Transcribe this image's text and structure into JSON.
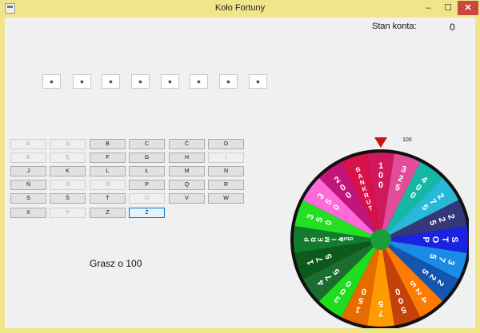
{
  "window": {
    "title": "Koło Fortuny",
    "minimize": "‒",
    "maximize": "☐",
    "close": "✕"
  },
  "balance": {
    "label": "Stan konta:",
    "value": "0"
  },
  "slots": [
    "●",
    "●",
    "●",
    "●",
    "●",
    "●",
    "●",
    "●"
  ],
  "keys": [
    {
      "label": "A",
      "enabled": false
    },
    {
      "label": "Ą",
      "enabled": false
    },
    {
      "label": "B",
      "enabled": true
    },
    {
      "label": "C",
      "enabled": true
    },
    {
      "label": "Ć",
      "enabled": true
    },
    {
      "label": "D",
      "enabled": true
    },
    {
      "label": "E",
      "enabled": false
    },
    {
      "label": "Ę",
      "enabled": false
    },
    {
      "label": "F",
      "enabled": true
    },
    {
      "label": "G",
      "enabled": true
    },
    {
      "label": "H",
      "enabled": true
    },
    {
      "label": "I",
      "enabled": false
    },
    {
      "label": "J",
      "enabled": true
    },
    {
      "label": "K",
      "enabled": true
    },
    {
      "label": "L",
      "enabled": true
    },
    {
      "label": "Ł",
      "enabled": true
    },
    {
      "label": "M",
      "enabled": true
    },
    {
      "label": "N",
      "enabled": true
    },
    {
      "label": "Ń",
      "enabled": true
    },
    {
      "label": "O",
      "enabled": false
    },
    {
      "label": "Ó",
      "enabled": false
    },
    {
      "label": "P",
      "enabled": true
    },
    {
      "label": "Q",
      "enabled": true
    },
    {
      "label": "R",
      "enabled": true
    },
    {
      "label": "S",
      "enabled": true
    },
    {
      "label": "Ś",
      "enabled": true
    },
    {
      "label": "T",
      "enabled": true
    },
    {
      "label": "U",
      "enabled": false
    },
    {
      "label": "V",
      "enabled": true
    },
    {
      "label": "W",
      "enabled": true
    },
    {
      "label": "X",
      "enabled": true
    },
    {
      "label": "Y",
      "enabled": false
    },
    {
      "label": "Z",
      "enabled": true
    },
    {
      "label": "Ż",
      "enabled": true,
      "focused": true
    }
  ],
  "status": {
    "text": "Grasz o 100"
  },
  "wheel": {
    "current_value": "100",
    "pointer_color": "#cc1111",
    "hub_color": "#1a9e3c",
    "rim_color": "#111111",
    "segments": [
      {
        "label": "100",
        "color": "#d0185e"
      },
      {
        "label": "325",
        "color": "#e24c9a"
      },
      {
        "label": "400",
        "color": "#16b8a4"
      },
      {
        "label": "275",
        "color": "#26b9d8"
      },
      {
        "label": "225",
        "color": "#34387a"
      },
      {
        "label": "STOP",
        "color": "#1a24e0"
      },
      {
        "label": "375",
        "color": "#1a8ce8"
      },
      {
        "label": "225",
        "color": "#1455b0"
      },
      {
        "label": "425",
        "color": "#ff7a00"
      },
      {
        "label": "500",
        "color": "#c4420a"
      },
      {
        "label": "75",
        "color": "#ff9a00"
      },
      {
        "label": "150",
        "color": "#e86a00"
      },
      {
        "label": "300",
        "color": "#1edc1e"
      },
      {
        "label": "475",
        "color": "#1b6e2e"
      },
      {
        "label": "175",
        "color": "#0c5a1c"
      },
      {
        "label": "PREMIA",
        "sub": "SUPER",
        "color": "#127c2e"
      },
      {
        "label": "350",
        "color": "#22e022"
      },
      {
        "label": "350",
        "color": "#ff6ad9"
      },
      {
        "label": "200",
        "color": "#c2157a"
      },
      {
        "label": "BANKRUT",
        "color": "#d9114a"
      }
    ]
  }
}
